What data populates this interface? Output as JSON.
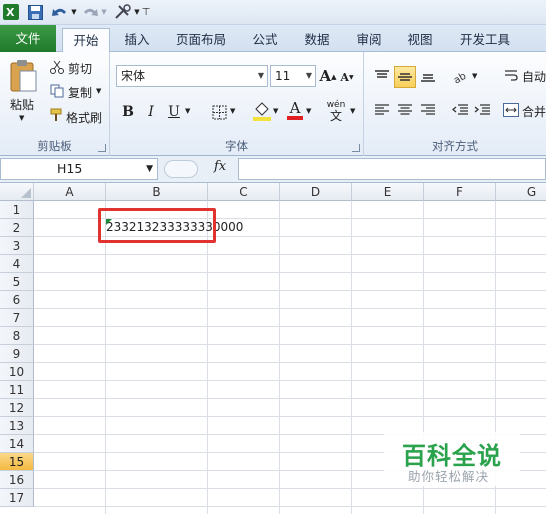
{
  "ribbon_tabs": [
    "文件",
    "开始",
    "插入",
    "页面布局",
    "公式",
    "数据",
    "审阅",
    "视图",
    "开发工具"
  ],
  "active_tab": "开始",
  "clipboard": {
    "paste": "粘贴",
    "cut": "剪切",
    "copy": "复制",
    "format_painter": "格式刷",
    "group_label": "剪贴板"
  },
  "font": {
    "name": "宋体",
    "size": "11",
    "bold": "B",
    "italic": "I",
    "underline": "U",
    "grow": "A",
    "shrink": "A",
    "color_letter": "A",
    "pinyin": "wén",
    "group_label": "字体",
    "font_color": "#e02020"
  },
  "alignment": {
    "wrap": "自动",
    "merge": "合并",
    "group_label": "对齐方式"
  },
  "formula_bar": {
    "name_box": "H15",
    "fx": "fx",
    "formula": ""
  },
  "columns": [
    "A",
    "B",
    "C",
    "D",
    "E",
    "F",
    "G"
  ],
  "rows": [
    "1",
    "2",
    "3",
    "4",
    "5",
    "6",
    "7",
    "8",
    "9",
    "10",
    "11",
    "12",
    "13",
    "14",
    "15",
    "16",
    "17"
  ],
  "active_row": "15",
  "cells": {
    "B2": "233213233333330000"
  },
  "watermark": {
    "title": "百科全说",
    "subtitle": "助你轻松解决"
  },
  "colors": {
    "file_tab": "#2b8a35",
    "highlight_box": "#e0322f",
    "watermark": "#2ba24c"
  }
}
